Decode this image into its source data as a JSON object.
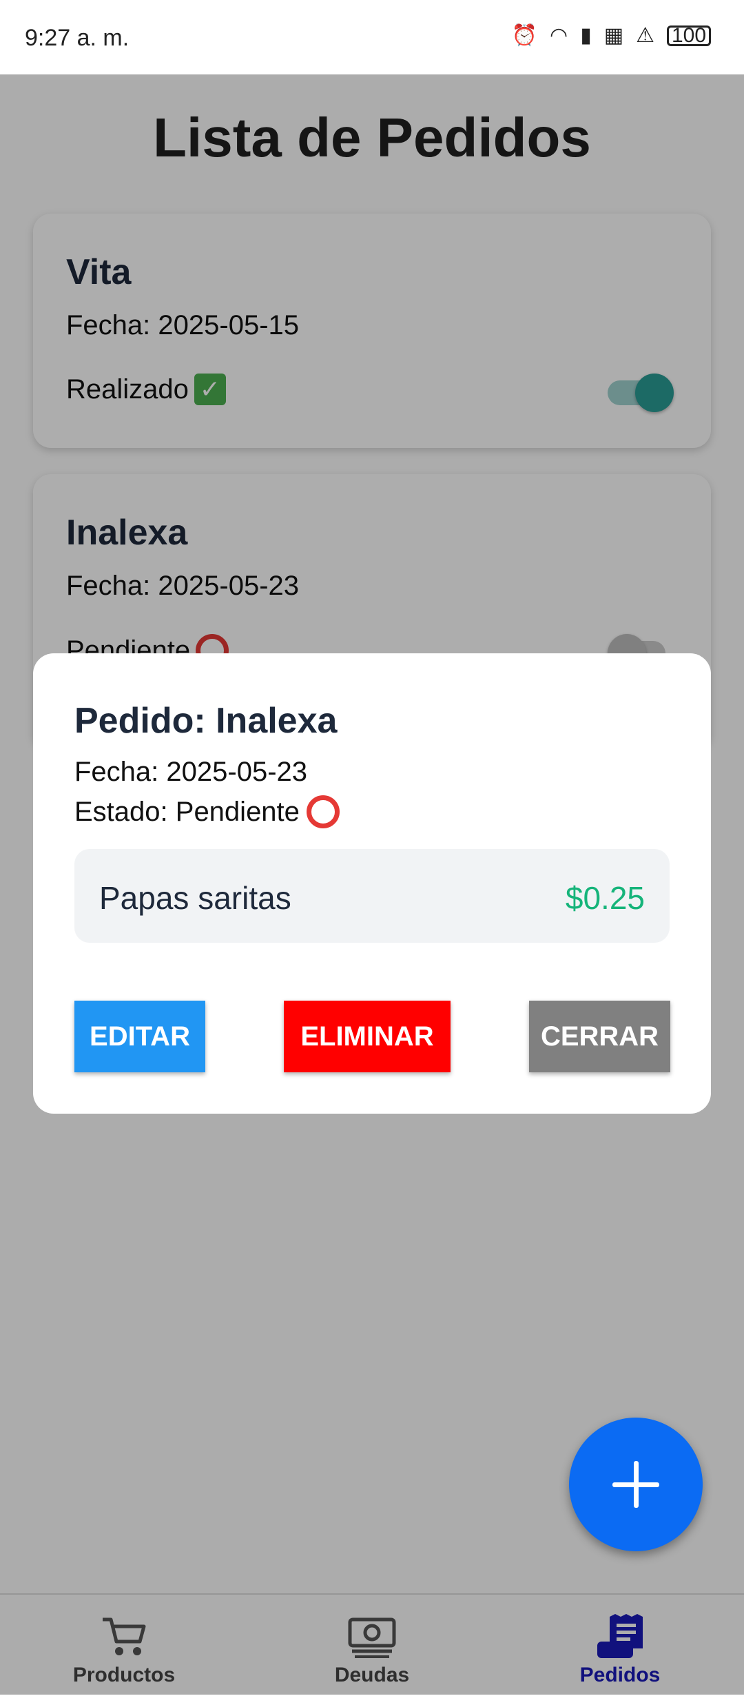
{
  "status_bar": {
    "time": "9:27 a. m.",
    "battery": "100"
  },
  "page": {
    "title": "Lista de Pedidos"
  },
  "orders": [
    {
      "name": "Vita",
      "date": "Fecha: 2025-05-15",
      "status": "Realizado",
      "completed": true
    },
    {
      "name": "Inalexa",
      "date": "Fecha: 2025-05-23",
      "status": "Pendiente",
      "completed": false
    }
  ],
  "modal": {
    "title": "Pedido: Inalexa",
    "date": "Fecha: 2025-05-23",
    "status": "Estado: Pendiente",
    "items": [
      {
        "name": "Papas saritas",
        "price": "$0.25"
      }
    ],
    "buttons": {
      "edit": "EDITAR",
      "delete": "ELIMINAR",
      "close": "CERRAR"
    }
  },
  "bottom_nav": {
    "items": [
      {
        "label": "Productos",
        "icon": "cart-icon"
      },
      {
        "label": "Deudas",
        "icon": "money-icon"
      },
      {
        "label": "Pedidos",
        "icon": "receipt-icon",
        "active": true
      }
    ]
  },
  "colors": {
    "accent": "#0b6bf3",
    "toggle_on": "#2a9d96",
    "price": "#16b47a",
    "edit": "#2196f3",
    "delete": "#ff0000",
    "close": "#808080",
    "nav_active": "#1a1ab8"
  }
}
